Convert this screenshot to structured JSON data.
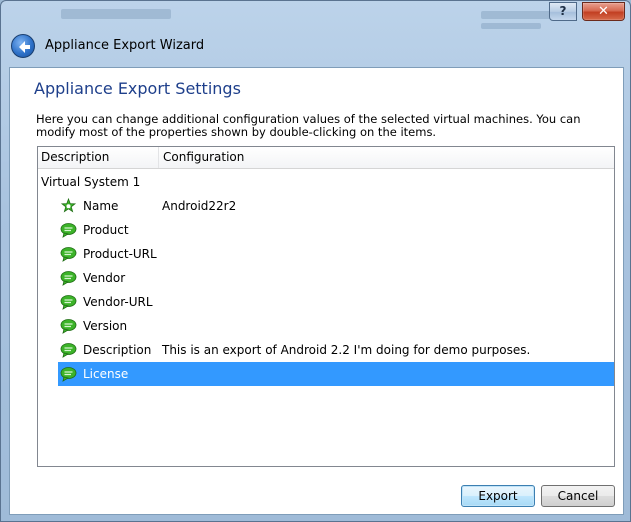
{
  "window": {
    "title": "Appliance Export Wizard",
    "help_label": "?",
    "close_label": "✕"
  },
  "page": {
    "heading": "Appliance Export Settings",
    "description": "Here you can change additional configuration values of the selected virtual machines. You can modify most of the properties shown by double-clicking on the items."
  },
  "tree": {
    "columns": [
      "Description",
      "Configuration"
    ],
    "system": "Virtual System 1",
    "items": [
      {
        "label": "Name",
        "value": "Android22r2",
        "icon": "name-star-icon"
      },
      {
        "label": "Product",
        "value": "",
        "icon": "speech-bubble-icon"
      },
      {
        "label": "Product-URL",
        "value": "",
        "icon": "speech-bubble-icon"
      },
      {
        "label": "Vendor",
        "value": "",
        "icon": "speech-bubble-icon"
      },
      {
        "label": "Vendor-URL",
        "value": "",
        "icon": "speech-bubble-icon"
      },
      {
        "label": "Version",
        "value": "",
        "icon": "speech-bubble-icon"
      },
      {
        "label": "Description",
        "value": "This is an export of Android 2.2 I'm doing for demo purposes.",
        "icon": "speech-bubble-icon"
      },
      {
        "label": "License",
        "value": "",
        "icon": "speech-bubble-icon",
        "selected": true
      }
    ]
  },
  "buttons": {
    "export": "Export",
    "cancel": "Cancel"
  },
  "colors": {
    "heading": "#1e3f8b",
    "selection": "#3399ff",
    "icon_green": "#3cb329"
  }
}
